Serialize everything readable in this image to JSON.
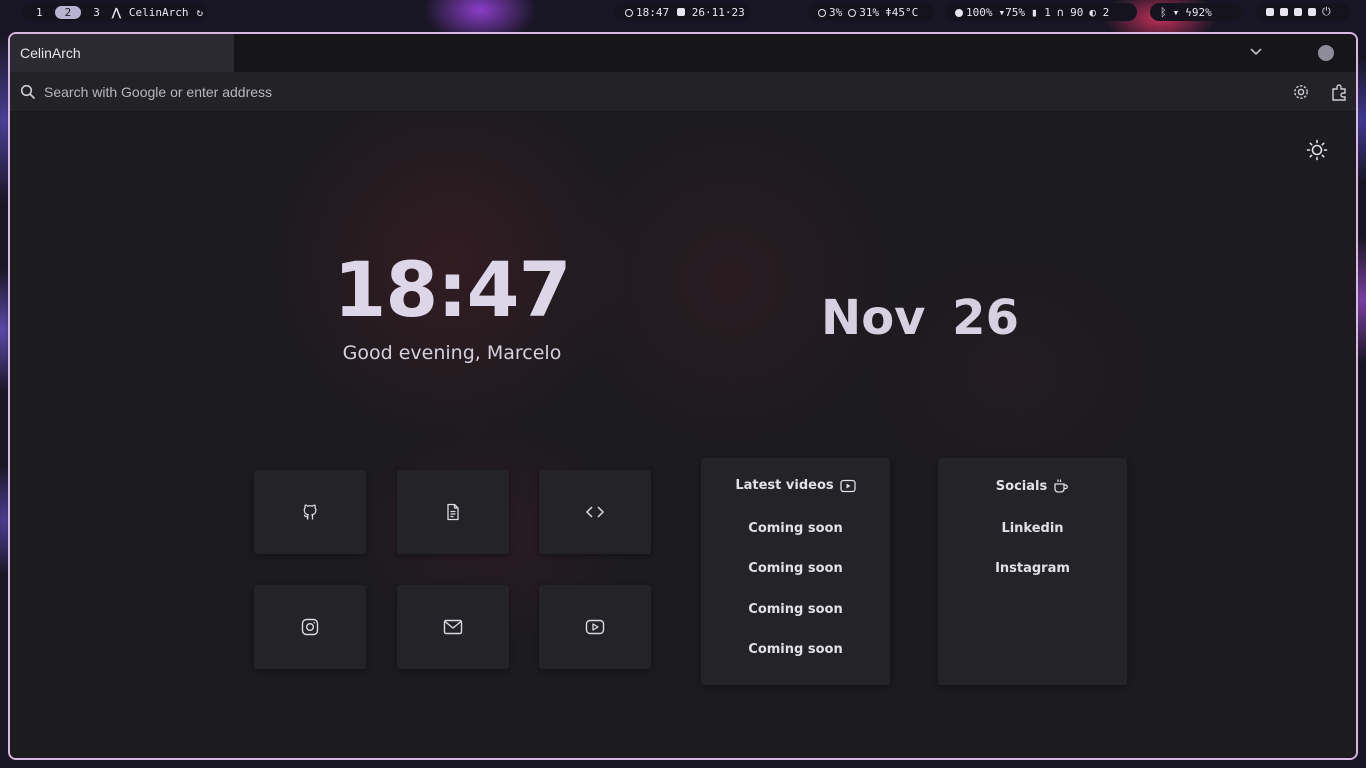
{
  "topbar": {
    "workspaces": [
      "1",
      "2",
      "3"
    ],
    "active_workspace": "2",
    "hostname": "CelinArch",
    "time": "18:47",
    "date": "26·11·23",
    "cpu": "3%",
    "memory": "31%",
    "temperature": "45°C",
    "brightness": "100%",
    "volume": "75%",
    "mic_count": "1",
    "headphones": "90",
    "notifications": "2",
    "battery": "92%"
  },
  "browser": {
    "tab_title": "CelinArch",
    "search_placeholder": "Search with Google or enter address"
  },
  "page": {
    "clock": "18:47",
    "greeting": "Good evening, Marcelo",
    "date": "Nov 26",
    "tiles": [
      "github-icon",
      "document-icon",
      "code-icon",
      "instagram-icon",
      "mail-icon",
      "youtube-icon"
    ],
    "videos": {
      "title": "Latest videos",
      "items": [
        "Coming soon",
        "Coming soon",
        "Coming soon",
        "Coming soon"
      ]
    },
    "socials": {
      "title": "Socials",
      "items": [
        "Linkedin",
        "Instagram"
      ]
    }
  },
  "colors": {
    "window_border": "#d8b7e0",
    "page_bg": "#1c1b1f",
    "card_bg": "#242328"
  }
}
